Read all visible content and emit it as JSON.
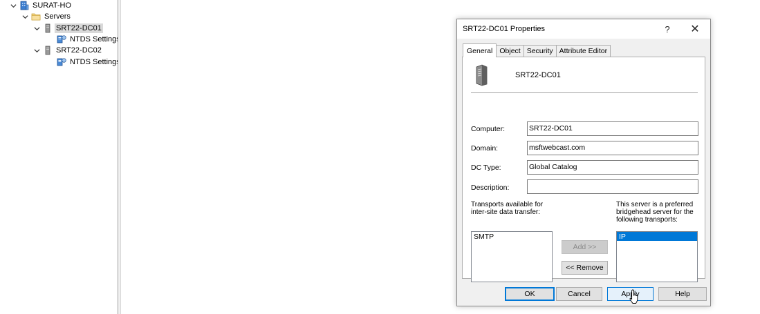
{
  "tree": {
    "items": [
      {
        "label": "SURAT-HO",
        "icon": "site-icon",
        "expanded": true
      },
      {
        "label": "Servers",
        "icon": "folder-icon",
        "expanded": true
      },
      {
        "label": "SRT22-DC01",
        "icon": "server-icon",
        "expanded": true,
        "selected": true
      },
      {
        "label": "NTDS Settings",
        "icon": "ntds-settings-icon"
      },
      {
        "label": "SRT22-DC02",
        "icon": "server-icon",
        "expanded": true
      },
      {
        "label": "NTDS Settings",
        "icon": "ntds-settings-icon"
      }
    ]
  },
  "dialog": {
    "title": "SRT22-DC01 Properties",
    "help_glyph": "?",
    "close_glyph": "✕",
    "tabs": [
      {
        "label": "General",
        "active": true
      },
      {
        "label": "Object"
      },
      {
        "label": "Security"
      },
      {
        "label": "Attribute Editor"
      }
    ],
    "server_name": "SRT22-DC01",
    "fields": {
      "computer": {
        "label": "Computer:",
        "value": "SRT22-DC01"
      },
      "domain": {
        "label": "Domain:",
        "value": "msftwebcast.com"
      },
      "dc_type": {
        "label": "DC Type:",
        "value": "Global Catalog"
      },
      "description": {
        "label": "Description:",
        "value": ""
      }
    },
    "transports_available_label": "Transports available for inter-site data transfer:",
    "bridgehead_label": "This server is a preferred bridgehead server for the following transports:",
    "available_transports": [
      "SMTP"
    ],
    "bridgehead_transports": [
      "IP"
    ],
    "add_label": "Add >>",
    "remove_label": "<< Remove",
    "ok_label": "OK",
    "cancel_label": "Cancel",
    "apply_label": "Apply",
    "help_label": "Help"
  },
  "colors": {
    "selection": "#0078d7",
    "dialog_bg": "#f0f0f0",
    "tree_selection": "#d9d9d9"
  }
}
